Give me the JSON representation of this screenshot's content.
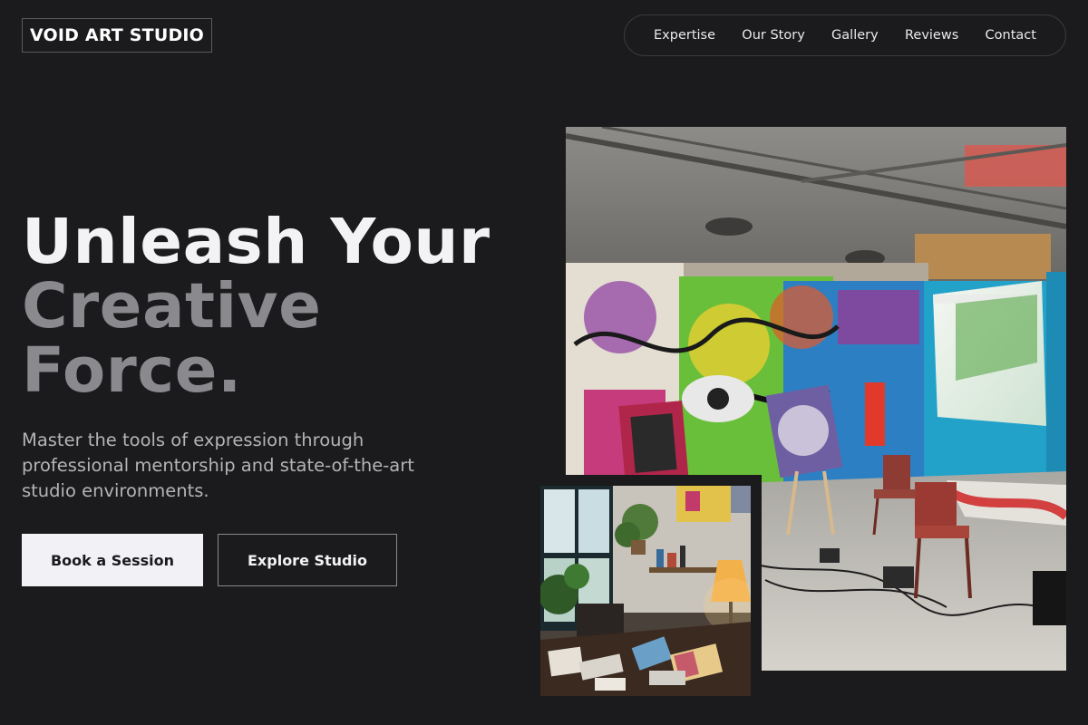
{
  "brand": {
    "name": "VOID ART STUDIO"
  },
  "nav": {
    "items": [
      {
        "label": "Expertise"
      },
      {
        "label": "Our Story"
      },
      {
        "label": "Gallery"
      },
      {
        "label": "Reviews"
      },
      {
        "label": "Contact"
      }
    ]
  },
  "hero": {
    "headline_line1": "Unleash Your",
    "headline_line2": "Creative",
    "headline_line3": "Force.",
    "subtitle": "Master the tools of expression through professional mentorship and state-of-the-art studio environments.",
    "primary_cta": "Book a Session",
    "secondary_cta": "Explore Studio"
  },
  "images": {
    "large": "graffiti-covered art studio loft with easels, chairs and large window",
    "small": "cozy home studio desk with plants, lamp and open sketchbooks"
  },
  "colors": {
    "background": "#1b1b1d",
    "headline_primary": "#f3f3f5",
    "headline_muted": "#8a8a8e",
    "subtitle": "#b4b4b8",
    "primary_button_bg": "#f2f2f6"
  }
}
